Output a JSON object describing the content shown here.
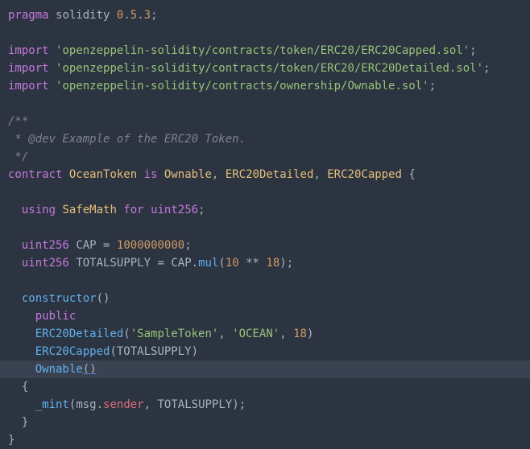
{
  "code": {
    "l0": {
      "pragma": "pragma",
      "solidity": "solidity",
      "num0": "0",
      "dot": ".",
      "num5": "5",
      "num3": "3",
      "semi": ";"
    },
    "l2": {
      "import": "import",
      "path": "'openzeppelin-solidity/contracts/token/ERC20/ERC20Capped.sol'",
      "semi": ";"
    },
    "l3": {
      "import": "import",
      "path": "'openzeppelin-solidity/contracts/token/ERC20/ERC20Detailed.sol'",
      "semi": ";"
    },
    "l4": {
      "import": "import",
      "path": "'openzeppelin-solidity/contracts/ownership/Ownable.sol'",
      "semi": ";"
    },
    "l6": {
      "comment": "/**"
    },
    "l7": {
      "comment": " * @dev Example of the ERC20 Token."
    },
    "l8": {
      "comment": " */"
    },
    "l9": {
      "contract": "contract",
      "name": "OceanToken",
      "is": "is",
      "ownable": "Ownable",
      "comma": ",",
      "erc20d": "ERC20Detailed",
      "erc20c": "ERC20Capped",
      "brace": "{"
    },
    "l11": {
      "indent": "  ",
      "using": "using",
      "safemath": "SafeMath",
      "for": "for",
      "uint256": "uint256",
      "semi": ";"
    },
    "l13": {
      "indent": "  ",
      "uint256": "uint256",
      "cap": "CAP",
      "eq": "=",
      "num": "1000000000",
      "semi": ";"
    },
    "l14": {
      "indent": "  ",
      "uint256": "uint256",
      "total": "TOTALSUPPLY",
      "eq": "=",
      "cap": "CAP",
      "dot": ".",
      "mul": "mul",
      "open": "(",
      "num10": "10",
      "star": "**",
      "num18": "18",
      "close": ")",
      "semi": ";"
    },
    "l16": {
      "indent": "  ",
      "constructor": "constructor",
      "parens": "()"
    },
    "l17": {
      "indent": "    ",
      "public": "public"
    },
    "l18": {
      "indent": "    ",
      "erc20d": "ERC20Detailed",
      "open": "(",
      "str1": "'SampleToken'",
      "comma": ",",
      "str2": "'OCEAN'",
      "num18": "18",
      "close": ")"
    },
    "l19": {
      "indent": "    ",
      "erc20c": "ERC20Capped",
      "open": "(",
      "total": "TOTALSUPPLY",
      "close": ")"
    },
    "l20": {
      "indent": "    ",
      "ownable": "Ownable",
      "parens": "()"
    },
    "l21": {
      "indent": "  ",
      "brace": "{"
    },
    "l22": {
      "indent": "    ",
      "mint": "_mint",
      "open": "(",
      "msg": "msg",
      "dot": ".",
      "sender": "sender",
      "comma": ",",
      "total": "TOTALSUPPLY",
      "close": ")",
      "semi": ";"
    },
    "l23": {
      "indent": "  ",
      "brace": "}"
    },
    "l24": {
      "brace": "}"
    }
  }
}
